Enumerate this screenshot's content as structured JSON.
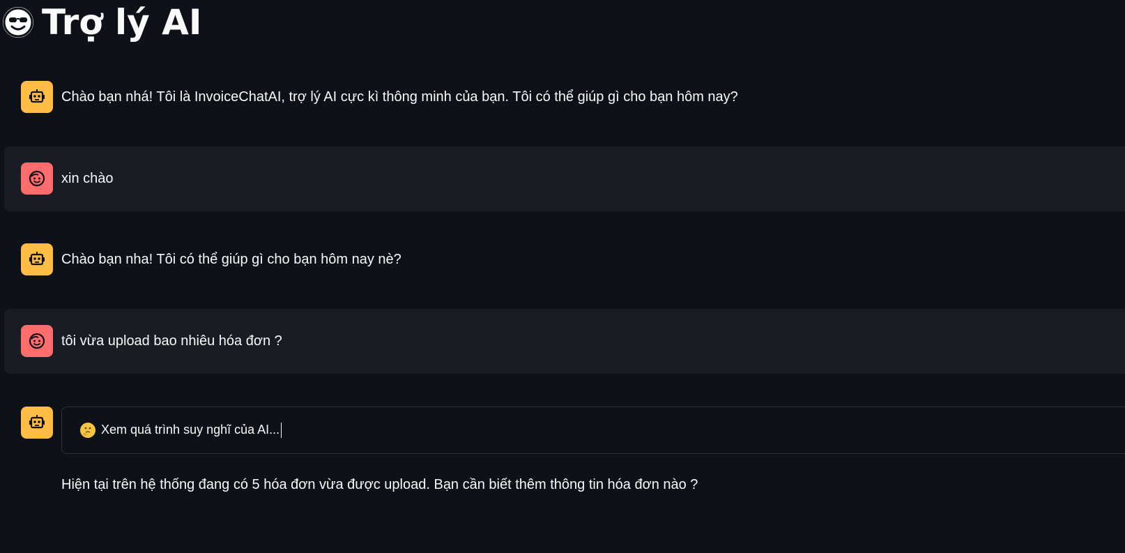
{
  "header": {
    "title": "Trợ lý AI",
    "icon": "smiling-face-with-sunglasses-icon"
  },
  "colors": {
    "background": "#0e1117",
    "user_message_bg": "#1a1c24",
    "bot_avatar": "#ffbd45",
    "user_avatar": "#ff6c6c",
    "text": "#fafafa"
  },
  "messages": [
    {
      "role": "assistant",
      "avatar_icon": "robot-icon",
      "text": "Chào bạn nhá! Tôi là InvoiceChatAI, trợ lý AI cực kì thông minh của bạn. Tôi có thể giúp gì cho bạn hôm nay?"
    },
    {
      "role": "user",
      "avatar_icon": "smiling-face-icon",
      "text": "xin chào"
    },
    {
      "role": "assistant",
      "avatar_icon": "robot-icon",
      "text": "Chào bạn nha! Tôi có thể giúp gì cho bạn hôm nay nè?"
    },
    {
      "role": "user",
      "avatar_icon": "smiling-face-icon",
      "text": "tôi vừa upload bao nhiêu hóa đơn ?"
    },
    {
      "role": "assistant",
      "avatar_icon": "robot-icon",
      "thinking": {
        "icon": "thinking-face-icon",
        "label": "Xem quá trình suy nghĩ của AI..."
      },
      "text": "Hiện tại trên hệ thống đang có 5 hóa đơn vừa được upload. Bạn cần biết thêm thông tin hóa đơn nào ?"
    }
  ]
}
